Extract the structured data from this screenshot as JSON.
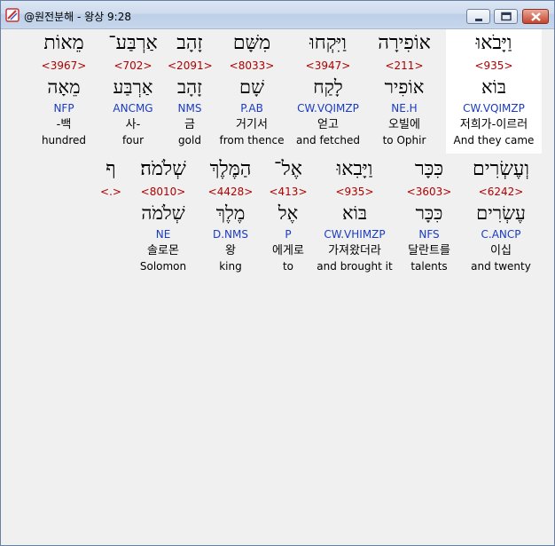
{
  "window": {
    "title": "@원전분해 - 왕상 9:28",
    "controls": {
      "minimize": "minimize",
      "maximize": "maximize",
      "close": "close"
    }
  },
  "rows": [
    {
      "words": [
        {
          "hebrew": "וַיָּבֹאוּ",
          "strong": "<935>",
          "lemma": "בּוֹא",
          "morph": "CW.VQIMZP",
          "korean": "저희가-이르러",
          "english": "And they came"
        },
        {
          "hebrew": "אוֹפִירָה",
          "strong": "<211>",
          "lemma": "אוֹפִיר",
          "morph": "NE.H",
          "korean": "오빌에",
          "english": "to Ophir"
        },
        {
          "hebrew": "וַיִּקְחוּ",
          "strong": "<3947>",
          "lemma": "לָקַח",
          "morph": "CW.VQIMZP",
          "korean": "얻고",
          "english": "and fetched"
        },
        {
          "hebrew": "מִשָּׁם",
          "strong": "<8033>",
          "lemma": "שָׁם",
          "morph": "P.AB",
          "korean": "거기서",
          "english": "from thence"
        },
        {
          "hebrew": "זָהָב",
          "strong": "<2091>",
          "lemma": "זָהָב",
          "morph": "NMS",
          "korean": "금",
          "english": "gold"
        },
        {
          "hebrew": "אַרְבַּע־",
          "strong": "<702>",
          "lemma": "אַרְבַּע",
          "morph": "ANCMG",
          "korean": "사-",
          "english": "four"
        },
        {
          "hebrew": "מֵאוֹת",
          "strong": "<3967>",
          "lemma": "מֵאָה",
          "morph": "NFP",
          "korean": "-백",
          "english": "hundred"
        }
      ]
    },
    {
      "words": [
        {
          "hebrew": "וְעֶשְׂרִים",
          "strong": "<6242>",
          "lemma": "עֶשְׂרִים",
          "morph": "C.ANCP",
          "korean": "이십",
          "english": "and twenty"
        },
        {
          "hebrew": "כִּכָּר",
          "strong": "<3603>",
          "lemma": "כִּכָּר",
          "morph": "NFS",
          "korean": "달란트를",
          "english": "talents"
        },
        {
          "hebrew": "וַיָּבִאוּ",
          "strong": "<935>",
          "lemma": "בּוֹא",
          "morph": "CW.VHIMZP",
          "korean": "가져왔더라",
          "english": "and brought it"
        },
        {
          "hebrew": "אֶל־",
          "strong": "<413>",
          "lemma": "אֶל",
          "morph": "P",
          "korean": "에게로",
          "english": "to"
        },
        {
          "hebrew": "הַמֶּלֶךְ",
          "strong": "<4428>",
          "lemma": "מֶלֶךְ",
          "morph": "D.NMS",
          "korean": "왕",
          "english": "king"
        },
        {
          "hebrew": "שְׁלֹמֹה׃",
          "strong": "<8010>",
          "lemma": "שְׁלֹמֹה",
          "morph": "NE",
          "korean": "솔로몬",
          "english": "Solomon"
        },
        {
          "hebrew": "ף",
          "strong": "<.>",
          "lemma": "",
          "morph": "",
          "korean": "",
          "english": ""
        }
      ]
    }
  ]
}
